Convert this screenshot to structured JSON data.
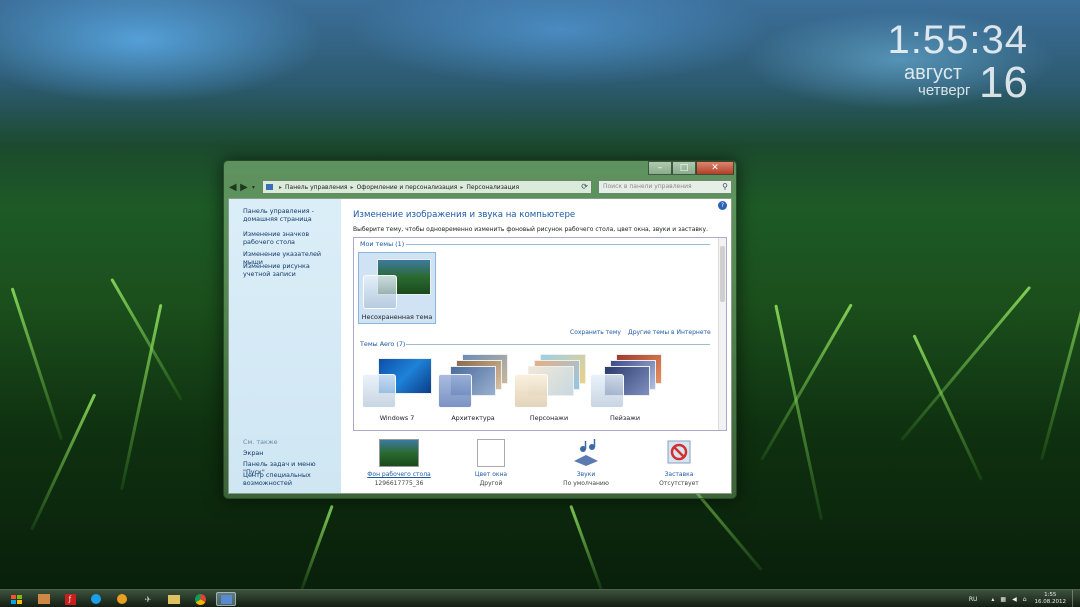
{
  "gadget_clock": {
    "time": "1:55:34",
    "month": "август",
    "weekday": "четверг",
    "day": "16"
  },
  "window": {
    "controls": {
      "minimize": "–",
      "maximize": "□",
      "close": "✕"
    },
    "address": {
      "crumbs": [
        "Панель управления",
        "Оформление и персонализация",
        "Персонализация"
      ]
    },
    "search": {
      "placeholder": "Поиск в панели управления"
    },
    "left_pane": {
      "links": [
        "Панель управления - домашняя страница",
        "Изменение значков рабочего стола",
        "Изменение указателей мыши",
        "Изменение рисунка учетной записи"
      ],
      "see_also_title": "См. также",
      "see_also": [
        "Экран",
        "Панель задач и меню \"Пуск\"",
        "Центр специальных возможностей"
      ]
    },
    "title": "Изменение изображения и звука на компьютере",
    "description": "Выберите тему, чтобы одновременно изменить фоновый рисунок рабочего стола, цвет окна, звуки и заставку.",
    "my_themes": {
      "header": "Мои темы (1)",
      "items": [
        {
          "label": "Несохраненная тема"
        }
      ],
      "save_theme": "Сохранить тему",
      "more_online": "Другие темы в Интернете"
    },
    "aero_themes": {
      "header": "Темы Aero (7)",
      "items": [
        {
          "label": "Windows 7"
        },
        {
          "label": "Архитектура"
        },
        {
          "label": "Персонажи"
        },
        {
          "label": "Пейзажи"
        }
      ]
    },
    "bottom": {
      "background": {
        "label": "Фон рабочего стола",
        "sub": "1296617775_36"
      },
      "color": {
        "label": "Цвет окна",
        "sub": "Другой"
      },
      "sounds": {
        "label": "Звуки",
        "sub": "По умолчанию"
      },
      "screensaver": {
        "label": "Заставка",
        "sub": "Отсутствует"
      }
    }
  },
  "taskbar": {
    "language": "RU",
    "time": "1:55",
    "date": "16.08.2012"
  },
  "colors": {
    "link": "#1e5aa5",
    "left_pane": "#dbeef8",
    "selection": "#cfe3f4"
  }
}
